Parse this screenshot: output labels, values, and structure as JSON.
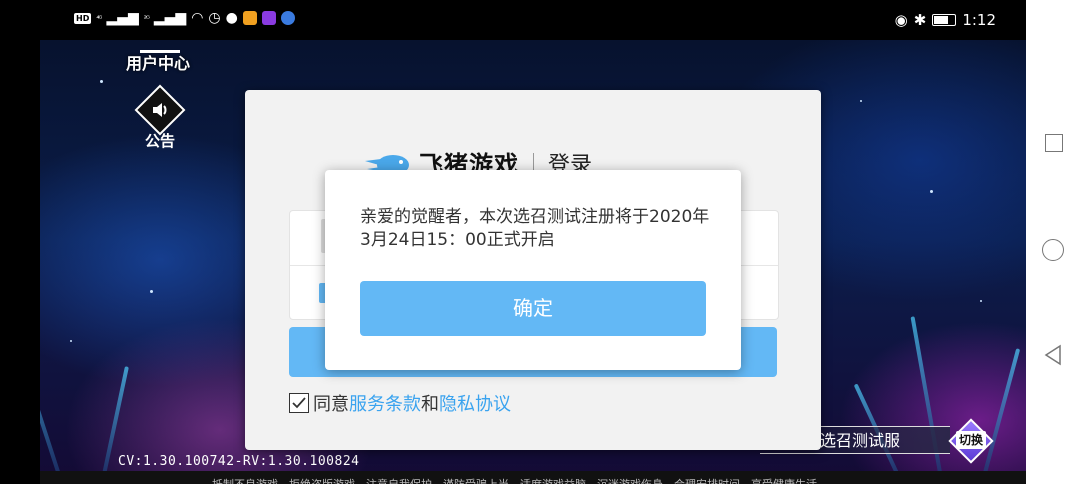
{
  "status_bar": {
    "left_badge": "HD",
    "signal_1": "⁴ᴳ",
    "signal_2": "²ᴳ",
    "time": "1:12"
  },
  "game": {
    "user_center_label": "用户中心",
    "notice_label": "公告",
    "version_text": "CV:1.30.100742-RV:1.30.100824",
    "server_name": "选召测试服",
    "switch_label": "切换",
    "health_notice": "抵制不良游戏，拒绝盗版游戏，注意自我保护，谨防受骗上当，适度游戏益脑，沉迷游戏伤身，合理安排时间，享受健康生活。"
  },
  "login": {
    "brand": "飞猪游戏",
    "title": "登录",
    "agree_prefix": "同意",
    "terms_link": "服务条款",
    "and_text": "和",
    "privacy_link": "隐私协议"
  },
  "dialog": {
    "message": "亲爱的觉醒者，本次选召测试注册将于2020年3月24日15：00正式开启",
    "confirm_label": "确定"
  },
  "colors": {
    "accent": "#63b8f5",
    "link": "#3aa3ef"
  }
}
